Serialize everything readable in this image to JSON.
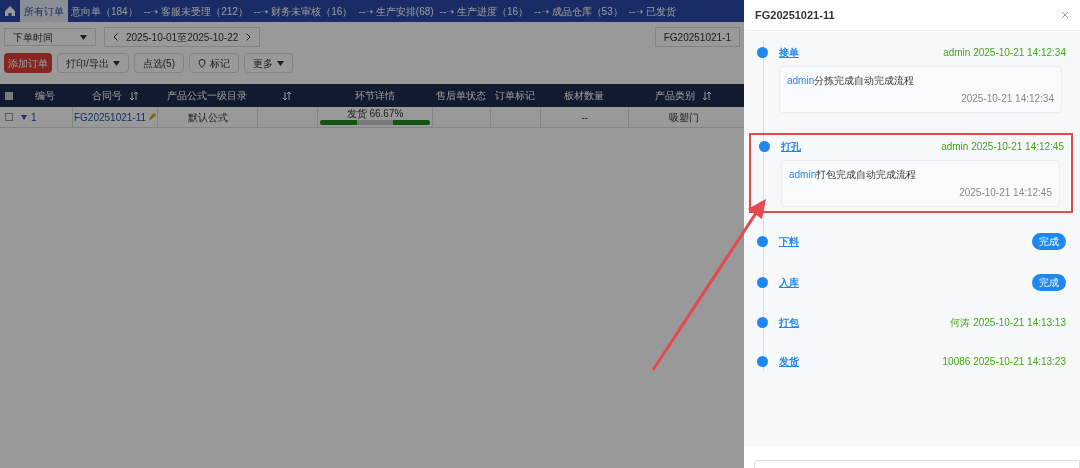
{
  "nav": {
    "tabs": [
      {
        "label": "所有订单",
        "selected": true
      },
      {
        "label": "意向单（184）",
        "selected": false
      },
      {
        "label": "--➝ 客服未受理（212）",
        "selected": false
      },
      {
        "label": "--➝ 财务未审核（16）",
        "selected": false
      },
      {
        "label": "--➝ 生产安排(68)",
        "selected": false
      },
      {
        "label": "--➝ 生产进度（16）",
        "selected": false
      },
      {
        "label": "--➝ 成品仓库（53）",
        "selected": false
      },
      {
        "label": "--➝ 已发货",
        "selected": false
      }
    ]
  },
  "filter": {
    "date_type": "下单时间",
    "date_range": "2025-10-01至2025-10-22",
    "search_value": "FG20251021-1"
  },
  "toolbar": [
    {
      "kind": "primary",
      "label": "添加订单"
    },
    {
      "kind": "menu",
      "label": "打印/导出"
    },
    {
      "kind": "plain",
      "label": "点选(5)"
    },
    {
      "kind": "pin",
      "label": "标记"
    },
    {
      "kind": "menu",
      "label": "更多"
    }
  ],
  "table": {
    "all_checked": false,
    "columns": [
      {
        "label": "编号",
        "sortable": false
      },
      {
        "label": "合同号",
        "sortable": true
      },
      {
        "label": "产品公式一级目录",
        "sortable": false
      },
      {
        "sortable": true
      },
      {
        "label": "环节详情",
        "sortable": false
      },
      {
        "label": "售后单状态",
        "sortable": false
      },
      {
        "label": "订单标记",
        "sortable": false
      },
      {
        "label": "板材数量",
        "sortable": false
      },
      {
        "label": "产品类别",
        "sortable": true
      }
    ],
    "rows": [
      {
        "checked": false,
        "expanded": false,
        "index": "1",
        "contract": "FG20251021-11",
        "formula": "默认公式",
        "progress": {
          "reading": "发货 66.67%",
          "segments": [
            {
              "done": true
            },
            {
              "done": false
            },
            {
              "done": true
            }
          ]
        },
        "sheet_count": "--",
        "category": "吸塑门"
      }
    ]
  },
  "drawer": {
    "title": "FG20251021-11",
    "steps": [
      {
        "title": "接单",
        "kind": "meta",
        "meta": "admin 2025-10-21 14:12:34",
        "highlighted": false,
        "comment": {
          "author": "admin",
          "text": "分拣完成自动完成流程",
          "time": "2025-10-21 14:12:34"
        }
      },
      {
        "title": "打孔",
        "kind": "meta",
        "meta": "admin 2025-10-21 14:12:45",
        "highlighted": true,
        "comment": {
          "author": "admin",
          "text": "打包完成自动完成流程",
          "time": "2025-10-21 14:12:45"
        }
      },
      {
        "title": "下料",
        "kind": "badge",
        "meta": "完成",
        "highlighted": false
      },
      {
        "title": "入库",
        "kind": "badge",
        "meta": "完成",
        "highlighted": false
      },
      {
        "title": "打包",
        "kind": "meta",
        "meta": "何涛 2025-10-21 14:13:13",
        "highlighted": false
      },
      {
        "title": "发货",
        "kind": "meta",
        "meta": "10086 2025-10-21 14:13:23",
        "highlighted": false
      }
    ]
  }
}
